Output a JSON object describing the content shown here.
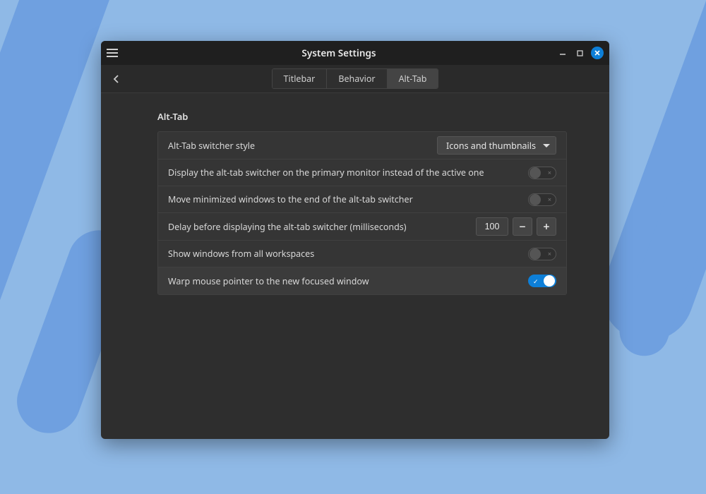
{
  "window": {
    "title": "System Settings"
  },
  "tabs": {
    "titlebar": "Titlebar",
    "behavior": "Behavior",
    "alttab": "Alt-Tab",
    "active": "alttab"
  },
  "section": {
    "title": "Alt-Tab"
  },
  "rows": {
    "style": {
      "label": "Alt-Tab switcher style",
      "value": "Icons and thumbnails"
    },
    "primary": {
      "label": "Display the alt-tab switcher on the primary monitor instead of the active one",
      "on": false
    },
    "move_min": {
      "label": "Move minimized windows to the end of the alt-tab switcher",
      "on": false
    },
    "delay": {
      "label": "Delay before displaying the alt-tab switcher (milliseconds)",
      "value": "100"
    },
    "all_ws": {
      "label": "Show windows from all workspaces",
      "on": false
    },
    "warp": {
      "label": "Warp mouse pointer to the new focused window",
      "on": true
    }
  },
  "glyphs": {
    "minus": "−",
    "plus": "+"
  }
}
